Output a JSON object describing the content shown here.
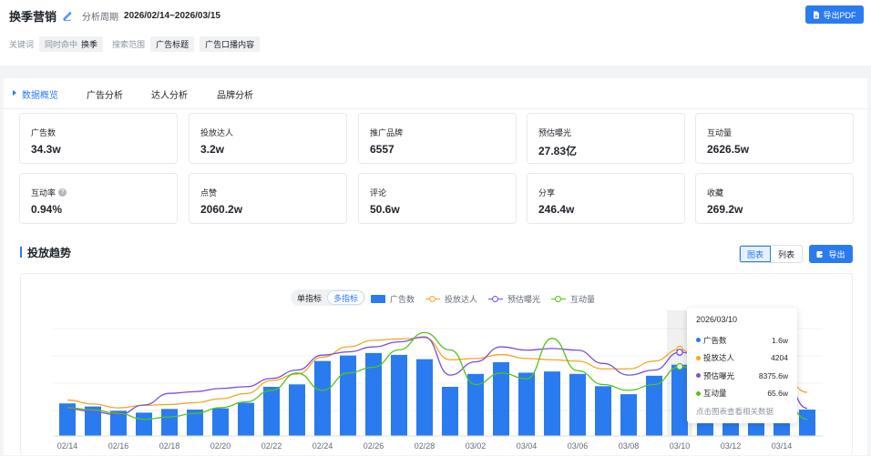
{
  "header": {
    "title": "换季营销",
    "period_label": "分析周期",
    "period_value": "2026/02/14~2026/03/15",
    "export_pdf": "导出PDF",
    "keyword_label": "关键词",
    "keyword_chip_prefix": "同时命中",
    "keyword_chip_value": "换季",
    "scope_label": "搜索范围",
    "scope_chips": [
      "广告标题",
      "广告口播内容"
    ]
  },
  "tabs": [
    "数据概览",
    "广告分析",
    "达人分析",
    "品牌分析"
  ],
  "metrics": [
    {
      "label": "广告数",
      "value": "34.3w"
    },
    {
      "label": "投放达人",
      "value": "3.2w"
    },
    {
      "label": "推广品牌",
      "value": "6557"
    },
    {
      "label": "预估曝光",
      "value": "27.83亿"
    },
    {
      "label": "互动量",
      "value": "2626.5w"
    },
    {
      "label": "互动率",
      "value": "0.94%"
    },
    {
      "label": "点赞",
      "value": "2060.2w"
    },
    {
      "label": "评论",
      "value": "50.6w"
    },
    {
      "label": "分享",
      "value": "246.4w"
    },
    {
      "label": "收藏",
      "value": "269.2w"
    }
  ],
  "trend": {
    "title": "投放趋势",
    "view_toggle": [
      "图表",
      "列表"
    ],
    "export": "导出",
    "mode_toggle": [
      "单指标",
      "多指标"
    ]
  },
  "colors": {
    "accent": "#2a7bf0",
    "bar": "#2a7bf0",
    "creators": "#f5a623",
    "exposure": "#7b4fe0",
    "interactions": "#52c41a"
  },
  "chart_data": {
    "type": "bar",
    "dates": [
      "02/14",
      "02/15",
      "02/16",
      "02/17",
      "02/18",
      "02/19",
      "02/20",
      "02/21",
      "02/22",
      "02/23",
      "02/24",
      "02/25",
      "02/26",
      "02/27",
      "02/28",
      "03/01",
      "03/02",
      "03/03",
      "03/04",
      "03/05",
      "03/06",
      "03/07",
      "03/08",
      "03/09",
      "03/10",
      "03/11",
      "03/12",
      "03/13",
      "03/14",
      "03/15"
    ],
    "x_tick_labels": [
      "02/14",
      "02/16",
      "02/18",
      "02/20",
      "02/22",
      "02/24",
      "02/26",
      "02/28",
      "03/02",
      "03/04",
      "03/06",
      "03/08",
      "03/10",
      "03/12",
      "03/14"
    ],
    "series": [
      {
        "name": "广告数",
        "type": "bar",
        "color": "#2a7bf0",
        "values": [
          0.53,
          0.48,
          0.41,
          0.38,
          0.44,
          0.43,
          0.45,
          0.54,
          0.8,
          0.84,
          1.22,
          1.31,
          1.35,
          1.32,
          1.25,
          0.8,
          1.01,
          1.2,
          1.03,
          1.05,
          1.01,
          0.81,
          0.68,
          0.98,
          1.16,
          0.95,
          1.02,
          0.9,
          0.72,
          0.43
        ]
      },
      {
        "name": "投放达人",
        "type": "line",
        "color": "#f5a623",
        "values": [
          2250,
          2100,
          1950,
          2050,
          2080,
          2150,
          2300,
          2500,
          3000,
          3250,
          3900,
          4300,
          4550,
          4600,
          4650,
          3800,
          3850,
          4000,
          3850,
          3800,
          3750,
          3450,
          3450,
          3750,
          4204,
          3500,
          3300,
          3250,
          3250,
          2550
        ]
      },
      {
        "name": "预估曝光",
        "type": "line",
        "color": "#7b4fe0",
        "values": [
          5000,
          4800,
          4600,
          5200,
          5900,
          6000,
          6200,
          6300,
          6800,
          7300,
          8200,
          8400,
          8700,
          9000,
          9300,
          7000,
          7800,
          8700,
          8500,
          8600,
          8500,
          7700,
          7000,
          7300,
          8375.6,
          8100,
          7800,
          7400,
          7100,
          5000
        ]
      },
      {
        "name": "互动量",
        "type": "line",
        "color": "#52c41a",
        "values": [
          30,
          28,
          25,
          20,
          22,
          25,
          30,
          35,
          45,
          60,
          45,
          60,
          65,
          80,
          95,
          80,
          50,
          60,
          55,
          90,
          62,
          50,
          45,
          50,
          65.6,
          60,
          52,
          50,
          40,
          20
        ]
      }
    ],
    "tooltip": {
      "date": "2026/03/10",
      "rows": [
        {
          "name": "广告数",
          "value": "1.6w",
          "color": "#2a7bf0"
        },
        {
          "name": "投放达人",
          "value": "4204",
          "color": "#f5a623"
        },
        {
          "name": "预估曝光",
          "value": "8375.6w",
          "color": "#7b4fe0"
        },
        {
          "name": "互动量",
          "value": "65.6w",
          "color": "#52c41a"
        }
      ],
      "footer": "点击图表查看相关数据"
    }
  }
}
